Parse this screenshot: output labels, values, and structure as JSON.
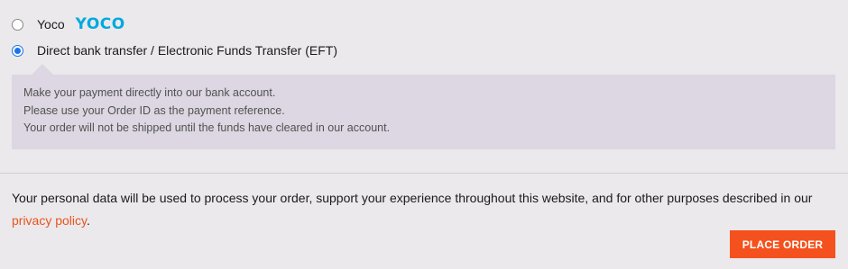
{
  "payment_methods": [
    {
      "label": "Yoco",
      "logo_text": "YOCO",
      "selected": false
    },
    {
      "label": "Direct bank transfer / Electronic Funds Transfer (EFT)",
      "selected": true
    }
  ],
  "eft_description": {
    "lines": [
      "Make your payment directly into our bank account.",
      "Please use your Order ID as the payment reference.",
      "Your order will not be shipped until the funds have cleared in our account."
    ]
  },
  "terms": {
    "text": "Your personal data will be used to process your order, support your experience throughout this website, and for other purposes described in our ",
    "link_text": "privacy policy",
    "suffix": "."
  },
  "place_order_button": "PLACE ORDER",
  "colors": {
    "accent": "#f4511e",
    "link": "#e8541e",
    "radio_selected": "#1a73e8",
    "yoco_logo": "#00a9e0"
  }
}
